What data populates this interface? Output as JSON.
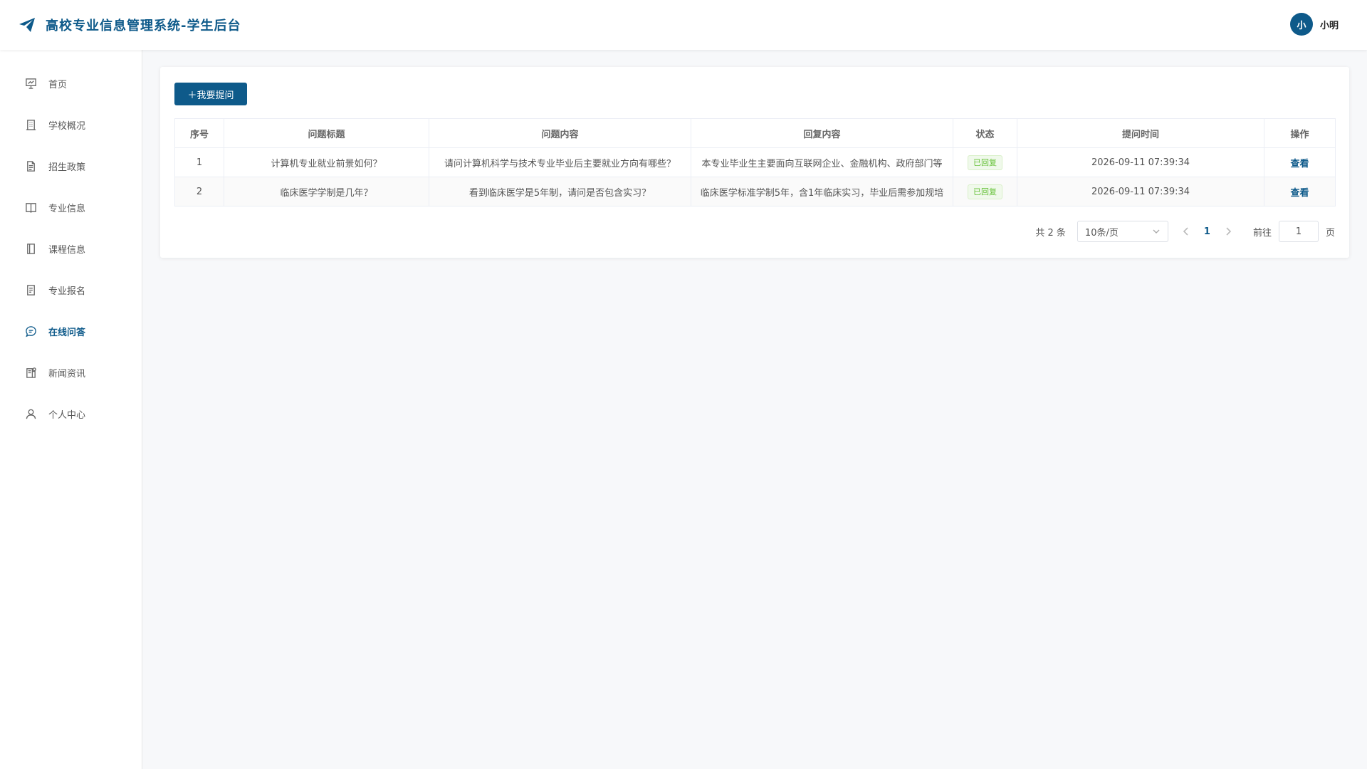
{
  "header": {
    "title": "高校专业信息管理系统-学生后台",
    "avatar_text": "小",
    "user_name": "小明",
    "icon": "paper-plane-icon"
  },
  "sidebar": {
    "items": [
      {
        "label": "首页",
        "icon": "presentation-icon"
      },
      {
        "label": "学校概况",
        "icon": "building-icon"
      },
      {
        "label": "招生政策",
        "icon": "document-icon"
      },
      {
        "label": "专业信息",
        "icon": "open-book-icon"
      },
      {
        "label": "课程信息",
        "icon": "notebook-icon"
      },
      {
        "label": "专业报名",
        "icon": "form-icon"
      },
      {
        "label": "在线问答",
        "icon": "chat-bubble-icon",
        "active": true
      },
      {
        "label": "新闻资讯",
        "icon": "news-icon"
      },
      {
        "label": "个人中心",
        "icon": "user-icon"
      }
    ]
  },
  "toolbar": {
    "add_label": "＋我要提问"
  },
  "table": {
    "columns": [
      "序号",
      "问题标题",
      "问题内容",
      "回复内容",
      "状态",
      "提问时间",
      "操作"
    ],
    "rows": [
      {
        "index": "1",
        "title": "计算机专业就业前景如何？",
        "content": "请问计算机科学与技术专业毕业后主要就业方向有哪些？",
        "reply": "本专业毕业生主要面向互联网企业、金融机构、政府部门等",
        "status": "已回复",
        "time": "2026-09-11 07:39:34",
        "action": "查看"
      },
      {
        "index": "2",
        "title": "临床医学学制是几年？",
        "content": "看到临床医学是5年制，请问是否包含实习？",
        "reply": "临床医学标准学制5年，含1年临床实习，毕业后需参加规培",
        "status": "已回复",
        "time": "2026-09-11 07:39:34",
        "action": "查看"
      }
    ]
  },
  "pagination": {
    "total_text": "共 2 条",
    "page_size": "10条/页",
    "current_page": "1",
    "goto_label": "前往",
    "goto_value": "1",
    "page_unit": "页"
  },
  "colors": {
    "primary": "#0e5a8a",
    "status_success": "#67c23a"
  }
}
